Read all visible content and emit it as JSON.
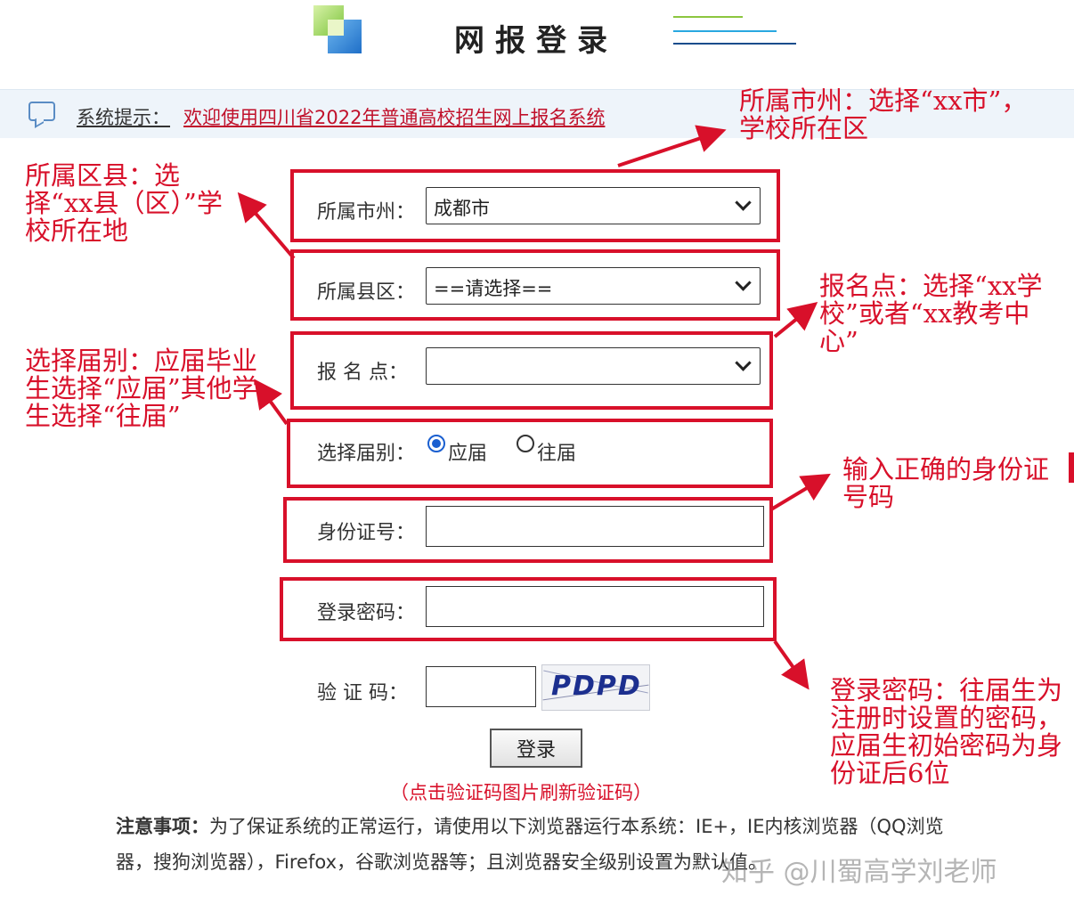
{
  "header": {
    "title": "网报登录"
  },
  "notice": {
    "label": "系统提示：",
    "text": "欢迎使用四川省2022年普通高校招生网上报名系统"
  },
  "form": {
    "city": {
      "label": "所属市州：",
      "value": "成都市"
    },
    "district": {
      "label": "所属县区：",
      "value": "==请选择=="
    },
    "site": {
      "label": "报 名 点：",
      "value": ""
    },
    "graduation": {
      "label": "选择届别：",
      "option1": "应届",
      "option2": "往届",
      "selected": "应届"
    },
    "id_number": {
      "label": "身份证号：",
      "value": ""
    },
    "password": {
      "label": "登录密码：",
      "value": ""
    },
    "captcha": {
      "label": "验 证 码：",
      "value": "",
      "image_text": "PDPD"
    },
    "login_button": "登录",
    "refresh_hint": "（点击验证码图片刷新验证码）"
  },
  "notes": {
    "title": "注意事项：",
    "text": "为了保证系统的正常运行，请使用以下浏览器运行本系统：IE+，IE内核浏览器（QQ浏览器，搜狗浏览器），Firefox，谷歌浏览器等；且浏览器安全级别设置为默认值。"
  },
  "annotations": {
    "city": "所属市州：选择“xx市”，学校所在区",
    "district": "所属区县：选择“xx县（区）”学校所在地",
    "site": "报名点：选择“xx学校”或者“xx教考中心”",
    "graduation": "选择届别：应届毕业生选择“应届”其他学生选择“往届”",
    "id_number": "输入正确的身份证号码",
    "password": "登录密码：往届生为注册时设置的密码，应届生初始密码为身份证后6位"
  },
  "watermark": "知乎 @川蜀高学刘老师",
  "colors": {
    "annotation_red": "#d8102a",
    "notice_bg": "#eef4fa",
    "notice_link": "#c0102a"
  }
}
